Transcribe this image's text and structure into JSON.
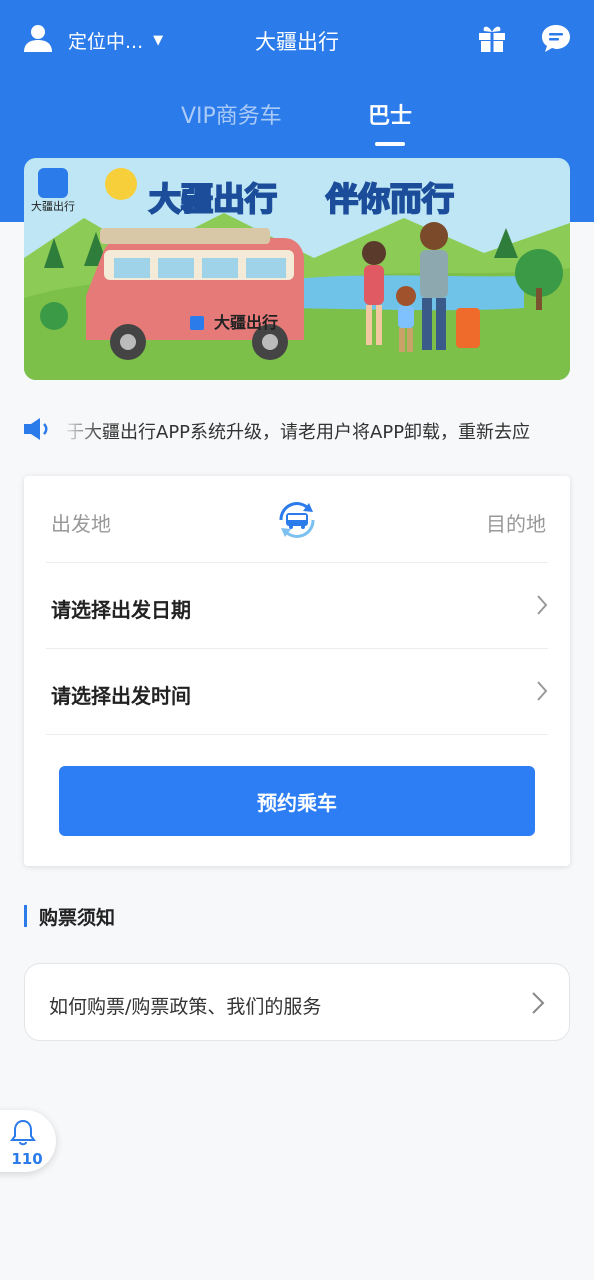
{
  "topbar": {
    "location": "定位中...",
    "title": "大疆出行",
    "icons": [
      "user-icon",
      "caret-down-icon",
      "gift-icon",
      "message-icon"
    ]
  },
  "tabs": [
    {
      "label": "VIP商务车",
      "active": false
    },
    {
      "label": "巴士",
      "active": true
    }
  ],
  "banner": {
    "logo_text": "大疆出行",
    "headline_left": "大疆出行",
    "headline_right": "伴你而行",
    "van_text": "大疆出行"
  },
  "notice": {
    "text": "于大疆出行APP系统升级，请老用户将APP卸载，重新去应"
  },
  "booking": {
    "departure": "出发地",
    "destination": "目的地",
    "date_label": "请选择出发日期",
    "time_label": "请选择出发时间",
    "button_label": "预约乘车"
  },
  "ticket_info": {
    "title": "购票须知",
    "link_text": "如何购票/购票政策、我们的服务"
  },
  "sos": {
    "number": "110"
  },
  "colors": {
    "brand_blue": "#2b7bea",
    "button_blue": "#2d7ef4",
    "background": "#f7f8fa"
  }
}
